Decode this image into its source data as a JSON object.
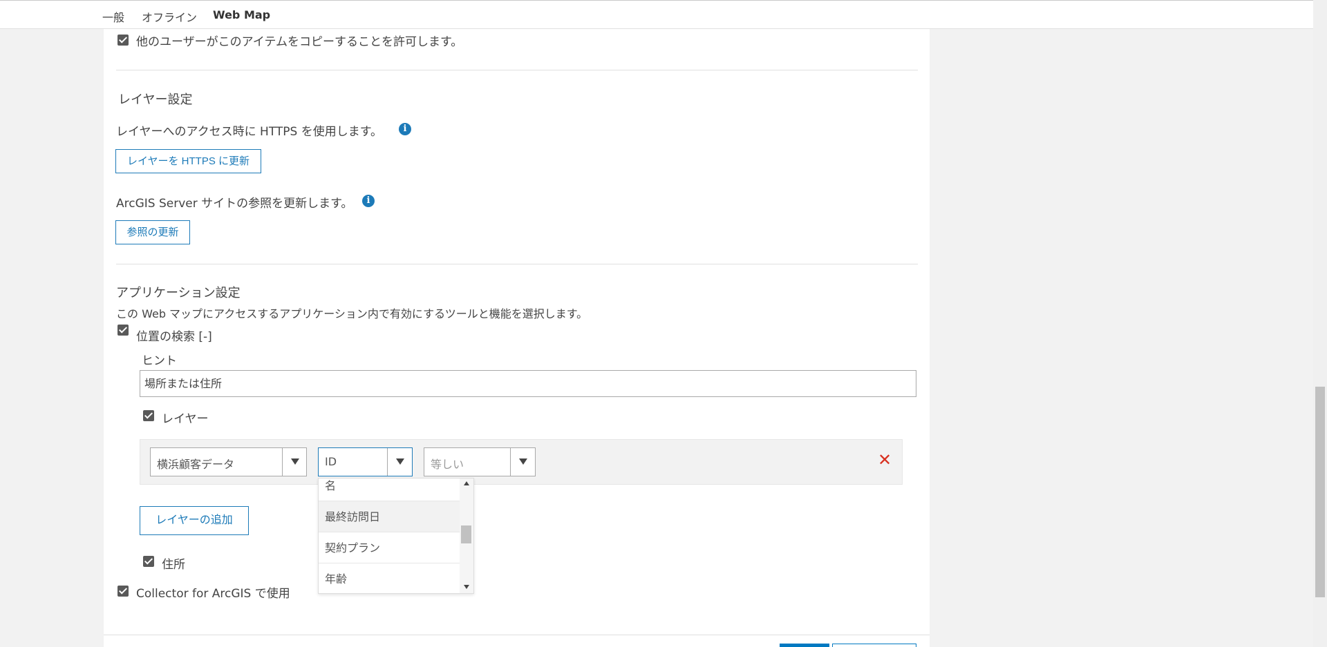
{
  "tabs": [
    {
      "label": "一般"
    },
    {
      "label": "オフライン"
    },
    {
      "label": "Web Map"
    }
  ],
  "copy_permission": {
    "label": "他のユーザーがこのアイテムをコピーすることを許可します。",
    "checked": true
  },
  "layer_settings": {
    "title": "レイヤー設定",
    "https_text": "レイヤーへのアクセス時に HTTPS を使用します。",
    "https_button": "レイヤーを HTTPS に更新",
    "server_text": "ArcGIS Server サイトの参照を更新します。",
    "server_button": "参照の更新",
    "info_icon": "i"
  },
  "app_settings": {
    "title": "アプリケーション設定",
    "description": "この Web マップにアクセスするアプリケーション内で有効にするツールと機能を選択します。",
    "location_search": {
      "label": "位置の検索 [-]",
      "checked": true
    },
    "hint_label": "ヒント",
    "hint_value": "場所または住所",
    "layer_checkbox": {
      "label": "レイヤー",
      "checked": true
    },
    "layer_row": {
      "layer_select": "横浜顧客データ",
      "field_select": "ID",
      "operator_select": "等しい",
      "remove_icon": "✕"
    },
    "field_options": [
      "名",
      "最終訪問日",
      "契約プラン",
      "年齢"
    ],
    "add_layer_button": "レイヤーの追加",
    "address_checkbox": {
      "label": "住所",
      "checked": true
    },
    "collector_checkbox": {
      "label": "Collector for ArcGIS で使用",
      "checked": true
    }
  },
  "colors": {
    "accent": "#1c7ab8",
    "remove": "#d83020",
    "primary": "#0079c1"
  }
}
